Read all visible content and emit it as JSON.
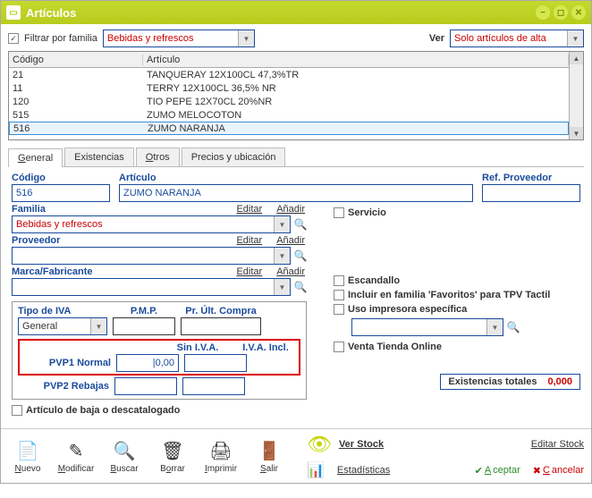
{
  "window": {
    "title": "Artículos"
  },
  "filter": {
    "by_family_label": "Filtrar por familia",
    "family_value": "Bebidas y refrescos",
    "ver_label": "Ver",
    "ver_value": "Solo artículos de alta"
  },
  "table": {
    "headers": {
      "codigo": "Código",
      "articulo": "Artículo"
    },
    "rows": [
      {
        "codigo": "21",
        "articulo": "TANQUERAY 12X100CL 47,3%TR"
      },
      {
        "codigo": "11",
        "articulo": "TERRY 12X100CL 36,5% NR"
      },
      {
        "codigo": "120",
        "articulo": "TIO PEPE 12X70CL 20%NR"
      },
      {
        "codigo": "515",
        "articulo": "ZUMO MELOCOTON"
      },
      {
        "codigo": "516",
        "articulo": "ZUMO NARANJA"
      }
    ]
  },
  "tabs": {
    "general": "General",
    "existencias": "Existencias",
    "otros": "Otros",
    "precios": "Precios y ubicación"
  },
  "form": {
    "codigo_label": "Código",
    "codigo_value": "516",
    "articulo_label": "Artículo",
    "articulo_value": "ZUMO NARANJA",
    "ref_prov_label": "Ref. Proveedor",
    "ref_prov_value": "",
    "familia_label": "Familia",
    "familia_value": "Bebidas y refrescos",
    "proveedor_label": "Proveedor",
    "proveedor_value": "",
    "marca_label": "Marca/Fabricante",
    "marca_value": "",
    "editar": "Editar",
    "anadir": "Añadir",
    "tipo_iva_label": "Tipo de IVA",
    "tipo_iva_value": "General",
    "pmp_label": "P.M.P.",
    "pmp_value": "",
    "ult_compra_label": "Pr. Últ. Compra",
    "ult_compra_value": "",
    "sin_iva_label": "Sin I.V.A.",
    "iva_incl_label": "I.V.A. Incl.",
    "pvp1_label": "PVP1 Normal",
    "pvp1_sin": "0,00",
    "pvp1_incl": "",
    "pvp2_label": "PVP2 Rebajas",
    "pvp2_sin": "",
    "pvp2_incl": "",
    "baja_label": "Artículo de baja o descatalogado",
    "servicio_label": "Servicio",
    "escandallo_label": "Escandallo",
    "incluir_fav_label": "Incluir en familia 'Favoritos' para TPV Tactil",
    "impresora_label": "Uso impresora específica",
    "impresora_value": "",
    "tienda_online_label": "Venta Tienda Online",
    "existencias_totales_label": "Existencias totales",
    "existencias_totales_value": "0,000"
  },
  "toolbar": {
    "nuevo": "Nuevo",
    "modificar": "Modificar",
    "buscar": "Buscar",
    "borrar": "Borrar",
    "imprimir": "Imprimir",
    "salir": "Salir",
    "ver_stock": "Ver Stock",
    "editar_stock": "Editar Stock",
    "estadisticas": "Estadísticas",
    "aceptar": "Aceptar",
    "cancelar": "Cancelar"
  }
}
